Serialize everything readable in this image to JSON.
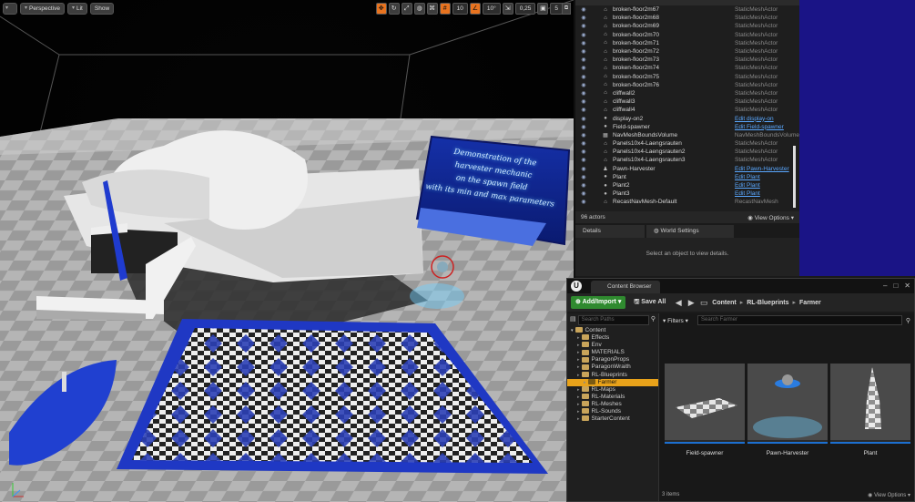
{
  "viewport": {
    "perspective_label": "Perspective",
    "lit_label": "Lit",
    "show_label": "Show",
    "grid_snap": "10",
    "rot_snap": "10°",
    "scale_snap": "0,25",
    "cam_speed": "5",
    "sign_lines": [
      "Demonstration of the",
      "harvester mechanic",
      "on the spawn field",
      "with its min and max parameters"
    ]
  },
  "outliner": {
    "rows": [
      {
        "name": "broken-floor2m67",
        "type": "StaticMeshActor",
        "link": false,
        "icon": "mesh"
      },
      {
        "name": "broken-floor2m68",
        "type": "StaticMeshActor",
        "link": false,
        "icon": "mesh"
      },
      {
        "name": "broken-floor2m69",
        "type": "StaticMeshActor",
        "link": false,
        "icon": "mesh"
      },
      {
        "name": "broken-floor2m70",
        "type": "StaticMeshActor",
        "link": false,
        "icon": "mesh"
      },
      {
        "name": "broken-floor2m71",
        "type": "StaticMeshActor",
        "link": false,
        "icon": "mesh"
      },
      {
        "name": "broken-floor2m72",
        "type": "StaticMeshActor",
        "link": false,
        "icon": "mesh"
      },
      {
        "name": "broken-floor2m73",
        "type": "StaticMeshActor",
        "link": false,
        "icon": "mesh"
      },
      {
        "name": "broken-floor2m74",
        "type": "StaticMeshActor",
        "link": false,
        "icon": "mesh"
      },
      {
        "name": "broken-floor2m75",
        "type": "StaticMeshActor",
        "link": false,
        "icon": "mesh"
      },
      {
        "name": "broken-floor2m76",
        "type": "StaticMeshActor",
        "link": false,
        "icon": "mesh"
      },
      {
        "name": "cliffwall2",
        "type": "StaticMeshActor",
        "link": false,
        "icon": "mesh"
      },
      {
        "name": "cliffwall3",
        "type": "StaticMeshActor",
        "link": false,
        "icon": "mesh"
      },
      {
        "name": "cliffwall4",
        "type": "StaticMeshActor",
        "link": false,
        "icon": "mesh"
      },
      {
        "name": "display-on2",
        "type": "Edit display-on",
        "link": true,
        "icon": "bp"
      },
      {
        "name": "Field-spawner",
        "type": "Edit Field-spawner",
        "link": true,
        "icon": "bp"
      },
      {
        "name": "NavMeshBoundsVolume",
        "type": "NavMeshBoundsVolume",
        "link": false,
        "icon": "vol"
      },
      {
        "name": "Panels10x4-Laengsrauten",
        "type": "StaticMeshActor",
        "link": false,
        "icon": "mesh"
      },
      {
        "name": "Panels10x4-Laengsrauten2",
        "type": "StaticMeshActor",
        "link": false,
        "icon": "mesh"
      },
      {
        "name": "Panels10x4-Laengsrauten3",
        "type": "StaticMeshActor",
        "link": false,
        "icon": "mesh"
      },
      {
        "name": "Pawn-Harvester",
        "type": "Edit Pawn-Harvester",
        "link": true,
        "icon": "pawn"
      },
      {
        "name": "Plant",
        "type": "Edit Plant",
        "link": true,
        "icon": "bp"
      },
      {
        "name": "Plant2",
        "type": "Edit Plant",
        "link": true,
        "icon": "bp"
      },
      {
        "name": "Plant3",
        "type": "Edit Plant",
        "link": true,
        "icon": "bp"
      },
      {
        "name": "RecastNavMesh-Default",
        "type": "RecastNavMesh",
        "link": false,
        "icon": "mesh"
      }
    ],
    "count": "96 actors",
    "view_options": "View Options"
  },
  "details": {
    "tab_details": "Details",
    "tab_world": "World Settings",
    "message": "Select an object to view details."
  },
  "content_browser": {
    "tab": "Content Browser",
    "add_import": "Add/Import",
    "save_all": "Save All",
    "crumbs": [
      "Content",
      "RL-Blueprints",
      "Farmer"
    ],
    "search_paths": "Search Paths",
    "filters": "Filters",
    "search_farmer": "Search Farmer",
    "tree": [
      {
        "label": "Content",
        "depth": 0,
        "sel": false
      },
      {
        "label": "Effects",
        "depth": 1,
        "sel": false
      },
      {
        "label": "Env",
        "depth": 1,
        "sel": false
      },
      {
        "label": "MATERIALS",
        "depth": 1,
        "sel": false
      },
      {
        "label": "ParagonProps",
        "depth": 1,
        "sel": false
      },
      {
        "label": "ParagonWraith",
        "depth": 1,
        "sel": false
      },
      {
        "label": "RL-Blueprints",
        "depth": 1,
        "sel": false
      },
      {
        "label": "Farmer",
        "depth": 2,
        "sel": true
      },
      {
        "label": "RL-Maps",
        "depth": 1,
        "sel": false
      },
      {
        "label": "RL-Materials",
        "depth": 1,
        "sel": false
      },
      {
        "label": "RL-Meshes",
        "depth": 1,
        "sel": false
      },
      {
        "label": "RL-Sounds",
        "depth": 1,
        "sel": false
      },
      {
        "label": "StarterContent",
        "depth": 1,
        "sel": false
      }
    ],
    "assets": [
      {
        "label": "Field-spawner"
      },
      {
        "label": "Pawn-Harvester"
      },
      {
        "label": "Plant"
      }
    ],
    "item_count": "3 items",
    "view_options": "View Options"
  }
}
